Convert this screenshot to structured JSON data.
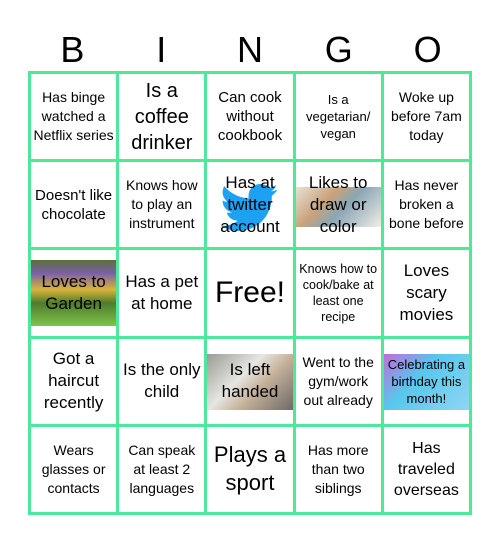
{
  "header": {
    "letters": [
      "B",
      "I",
      "N",
      "G",
      "O"
    ]
  },
  "theme": {
    "grid_color": "#4de89a",
    "text_color": "#000000"
  },
  "cells": [
    {
      "text": "Has binge watched a Netflix series"
    },
    {
      "text": "Is a coffee drinker"
    },
    {
      "text": "Can cook without cookbook"
    },
    {
      "text": "Is a vegetarian/ vegan"
    },
    {
      "text": "Woke up before 7am today"
    },
    {
      "text": "Doesn't like chocolate"
    },
    {
      "text": "Knows how to play an instrument"
    },
    {
      "text": "Has at twitter account",
      "image": "twitter-bird-icon"
    },
    {
      "text": "Likes to draw or color",
      "image": "art-supplies-image"
    },
    {
      "text": "Has never broken a bone before"
    },
    {
      "text": "Loves to Garden",
      "image": "garden-image"
    },
    {
      "text": "Has a pet at home"
    },
    {
      "text": "Free!"
    },
    {
      "text": "Knows how to cook/bake at least one recipe"
    },
    {
      "text": "Loves scary movies"
    },
    {
      "text": "Got a haircut recently"
    },
    {
      "text": "Is the only child"
    },
    {
      "text": "Is left handed",
      "image": "writing-hand-image"
    },
    {
      "text": "Went to the gym/work out already"
    },
    {
      "text": "Celebrating a birthday this month!",
      "image": "birthday-image"
    },
    {
      "text": "Wears glasses or contacts"
    },
    {
      "text": "Can speak at least 2 languages"
    },
    {
      "text": "Plays a sport"
    },
    {
      "text": "Has more than two siblings"
    },
    {
      "text": "Has traveled overseas"
    }
  ]
}
